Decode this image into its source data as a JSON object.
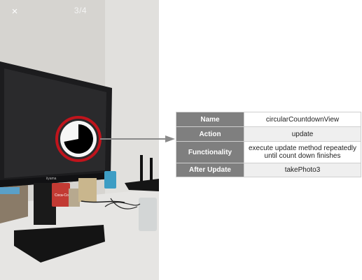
{
  "viewer": {
    "close_icon": "×",
    "page_counter": "3/4"
  },
  "annotation": {
    "rows": [
      {
        "key": "Name",
        "value": "circularCountdownView"
      },
      {
        "key": "Action",
        "value": "update"
      },
      {
        "key": "Functionality",
        "value": "execute update method repeatedly until count down finishes"
      },
      {
        "key": "After Update",
        "value": "takePhoto3"
      }
    ]
  },
  "countdown": {
    "progress_fraction": 0.72,
    "ring_color": "#c0141c",
    "connector_color": "#8a8a8a"
  },
  "photo_product_text": {
    "monitor_brand": "iiyama",
    "can_label": "Coca-Cola"
  }
}
